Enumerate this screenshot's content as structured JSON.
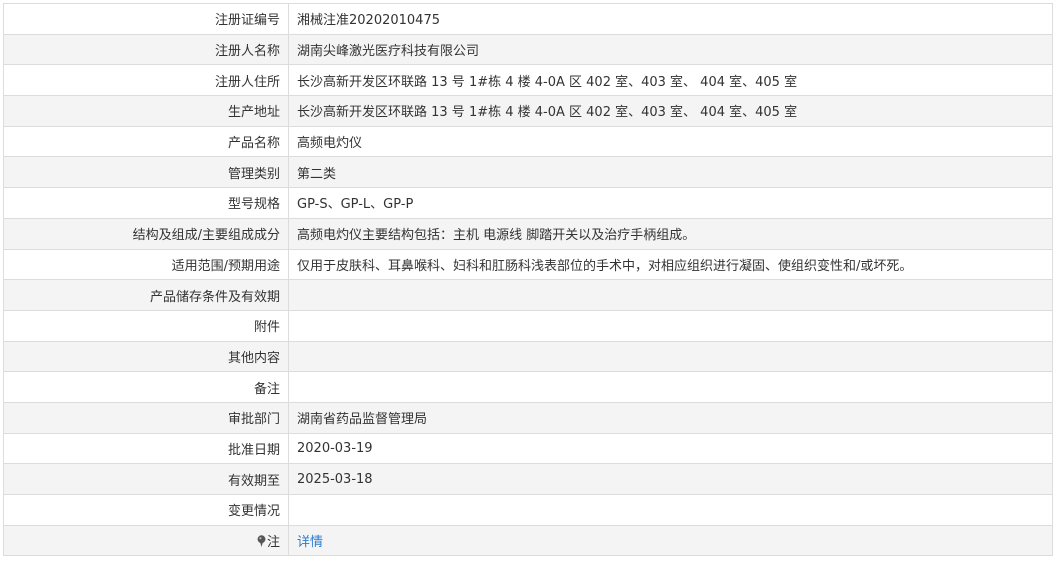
{
  "rows": [
    {
      "label": "注册证编号",
      "value": "湘械注准20202010475"
    },
    {
      "label": "注册人名称",
      "value": "湖南尖峰激光医疗科技有限公司"
    },
    {
      "label": "注册人住所",
      "value": "长沙高新开发区环联路 13 号 1#栋 4 楼 4-0A 区 402 室、403 室、 404 室、405 室"
    },
    {
      "label": "生产地址",
      "value": "长沙高新开发区环联路 13 号 1#栋 4 楼 4-0A 区 402 室、403 室、 404 室、405 室"
    },
    {
      "label": "产品名称",
      "value": "高频电灼仪"
    },
    {
      "label": "管理类别",
      "value": "第二类"
    },
    {
      "label": "型号规格",
      "value": "GP-S、GP-L、GP-P"
    },
    {
      "label": "结构及组成/主要组成成分",
      "value": "高频电灼仪主要结构包括：主机 电源线 脚踏开关以及治疗手柄组成。"
    },
    {
      "label": "适用范围/预期用途",
      "value": "仅用于皮肤科、耳鼻喉科、妇科和肛肠科浅表部位的手术中，对相应组织进行凝固、使组织变性和/或坏死。"
    },
    {
      "label": "产品储存条件及有效期",
      "value": ""
    },
    {
      "label": "附件",
      "value": ""
    },
    {
      "label": "其他内容",
      "value": ""
    },
    {
      "label": "备注",
      "value": ""
    },
    {
      "label": "审批部门",
      "value": "湖南省药品监督管理局"
    },
    {
      "label": "批准日期",
      "value": "2020-03-19"
    },
    {
      "label": "有效期至",
      "value": "2025-03-18"
    },
    {
      "label": "变更情况",
      "value": ""
    }
  ],
  "note_row": {
    "icon": "pin-icon",
    "label": "注",
    "link_text": "详情"
  },
  "colors": {
    "border": "#dcdcdc",
    "stripe": "#f4f4f4",
    "link": "#2a7bd1",
    "text": "#333333"
  }
}
